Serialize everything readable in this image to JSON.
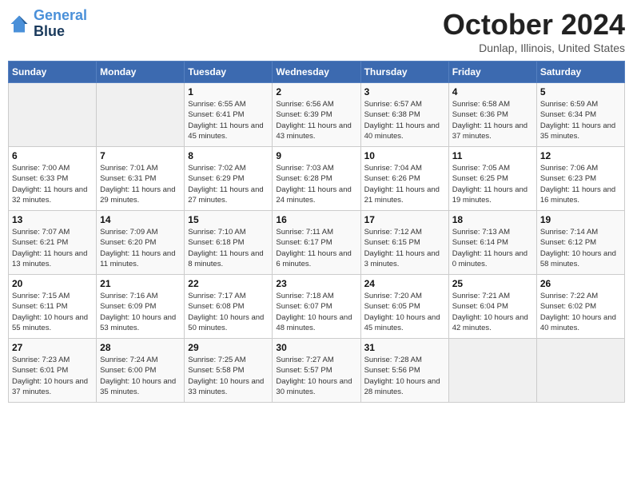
{
  "header": {
    "logo_line1": "General",
    "logo_line2": "Blue",
    "month": "October 2024",
    "location": "Dunlap, Illinois, United States"
  },
  "weekdays": [
    "Sunday",
    "Monday",
    "Tuesday",
    "Wednesday",
    "Thursday",
    "Friday",
    "Saturday"
  ],
  "days": [
    {
      "date": "",
      "empty": true
    },
    {
      "date": "",
      "empty": true
    },
    {
      "num": "1",
      "sunrise": "6:55 AM",
      "sunset": "6:41 PM",
      "daylight": "11 hours and 45 minutes."
    },
    {
      "num": "2",
      "sunrise": "6:56 AM",
      "sunset": "6:39 PM",
      "daylight": "11 hours and 43 minutes."
    },
    {
      "num": "3",
      "sunrise": "6:57 AM",
      "sunset": "6:38 PM",
      "daylight": "11 hours and 40 minutes."
    },
    {
      "num": "4",
      "sunrise": "6:58 AM",
      "sunset": "6:36 PM",
      "daylight": "11 hours and 37 minutes."
    },
    {
      "num": "5",
      "sunrise": "6:59 AM",
      "sunset": "6:34 PM",
      "daylight": "11 hours and 35 minutes."
    },
    {
      "num": "6",
      "sunrise": "7:00 AM",
      "sunset": "6:33 PM",
      "daylight": "11 hours and 32 minutes."
    },
    {
      "num": "7",
      "sunrise": "7:01 AM",
      "sunset": "6:31 PM",
      "daylight": "11 hours and 29 minutes."
    },
    {
      "num": "8",
      "sunrise": "7:02 AM",
      "sunset": "6:29 PM",
      "daylight": "11 hours and 27 minutes."
    },
    {
      "num": "9",
      "sunrise": "7:03 AM",
      "sunset": "6:28 PM",
      "daylight": "11 hours and 24 minutes."
    },
    {
      "num": "10",
      "sunrise": "7:04 AM",
      "sunset": "6:26 PM",
      "daylight": "11 hours and 21 minutes."
    },
    {
      "num": "11",
      "sunrise": "7:05 AM",
      "sunset": "6:25 PM",
      "daylight": "11 hours and 19 minutes."
    },
    {
      "num": "12",
      "sunrise": "7:06 AM",
      "sunset": "6:23 PM",
      "daylight": "11 hours and 16 minutes."
    },
    {
      "num": "13",
      "sunrise": "7:07 AM",
      "sunset": "6:21 PM",
      "daylight": "11 hours and 13 minutes."
    },
    {
      "num": "14",
      "sunrise": "7:09 AM",
      "sunset": "6:20 PM",
      "daylight": "11 hours and 11 minutes."
    },
    {
      "num": "15",
      "sunrise": "7:10 AM",
      "sunset": "6:18 PM",
      "daylight": "11 hours and 8 minutes."
    },
    {
      "num": "16",
      "sunrise": "7:11 AM",
      "sunset": "6:17 PM",
      "daylight": "11 hours and 6 minutes."
    },
    {
      "num": "17",
      "sunrise": "7:12 AM",
      "sunset": "6:15 PM",
      "daylight": "11 hours and 3 minutes."
    },
    {
      "num": "18",
      "sunrise": "7:13 AM",
      "sunset": "6:14 PM",
      "daylight": "11 hours and 0 minutes."
    },
    {
      "num": "19",
      "sunrise": "7:14 AM",
      "sunset": "6:12 PM",
      "daylight": "10 hours and 58 minutes."
    },
    {
      "num": "20",
      "sunrise": "7:15 AM",
      "sunset": "6:11 PM",
      "daylight": "10 hours and 55 minutes."
    },
    {
      "num": "21",
      "sunrise": "7:16 AM",
      "sunset": "6:09 PM",
      "daylight": "10 hours and 53 minutes."
    },
    {
      "num": "22",
      "sunrise": "7:17 AM",
      "sunset": "6:08 PM",
      "daylight": "10 hours and 50 minutes."
    },
    {
      "num": "23",
      "sunrise": "7:18 AM",
      "sunset": "6:07 PM",
      "daylight": "10 hours and 48 minutes."
    },
    {
      "num": "24",
      "sunrise": "7:20 AM",
      "sunset": "6:05 PM",
      "daylight": "10 hours and 45 minutes."
    },
    {
      "num": "25",
      "sunrise": "7:21 AM",
      "sunset": "6:04 PM",
      "daylight": "10 hours and 42 minutes."
    },
    {
      "num": "26",
      "sunrise": "7:22 AM",
      "sunset": "6:02 PM",
      "daylight": "10 hours and 40 minutes."
    },
    {
      "num": "27",
      "sunrise": "7:23 AM",
      "sunset": "6:01 PM",
      "daylight": "10 hours and 37 minutes."
    },
    {
      "num": "28",
      "sunrise": "7:24 AM",
      "sunset": "6:00 PM",
      "daylight": "10 hours and 35 minutes."
    },
    {
      "num": "29",
      "sunrise": "7:25 AM",
      "sunset": "5:58 PM",
      "daylight": "10 hours and 33 minutes."
    },
    {
      "num": "30",
      "sunrise": "7:27 AM",
      "sunset": "5:57 PM",
      "daylight": "10 hours and 30 minutes."
    },
    {
      "num": "31",
      "sunrise": "7:28 AM",
      "sunset": "5:56 PM",
      "daylight": "10 hours and 28 minutes."
    },
    {
      "date": "",
      "empty": true
    },
    {
      "date": "",
      "empty": true
    }
  ]
}
